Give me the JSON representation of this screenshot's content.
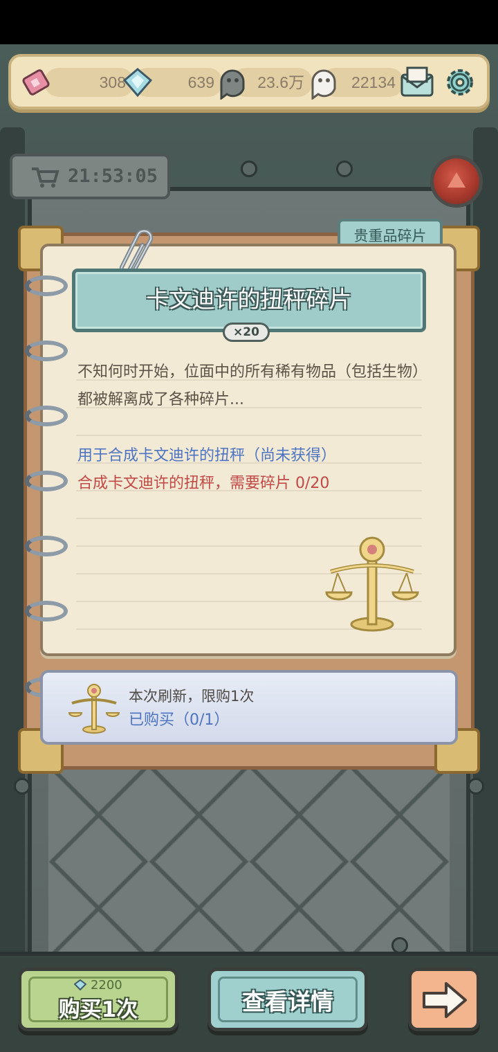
{
  "resources": {
    "ticket_value": "308",
    "diamond_value": "639",
    "gray_ghost_value": "23.6万",
    "white_ghost_value": "22134"
  },
  "timer": {
    "value": "21:53:05"
  },
  "item": {
    "tab_label": "贵重品碎片",
    "name": "卡文迪许的扭秤碎片",
    "quantity": "×20",
    "description": "不知何时开始，位面中的所有稀有物品（包括生物）都被解离成了各种碎片...",
    "usage": "用于合成卡文迪许的扭秤（尚未获得）",
    "requirement": "合成卡文迪许的扭秤，需要碎片  0/20"
  },
  "purchase": {
    "limit_text": "本次刷新，限购1次",
    "bought_text": "已购买（0/1）"
  },
  "buttons": {
    "buy_price": "2200",
    "buy_label": "购买1次",
    "detail_label": "查看详情"
  },
  "icons": {
    "ticket": "ticket-icon",
    "diamond": "diamond-icon",
    "gray_ghost": "gray-ghost-icon",
    "white_ghost": "white-ghost-icon",
    "mail": "mail-icon",
    "settings": "gear-icon",
    "cart": "cart-icon",
    "next": "arrow-right-icon"
  }
}
